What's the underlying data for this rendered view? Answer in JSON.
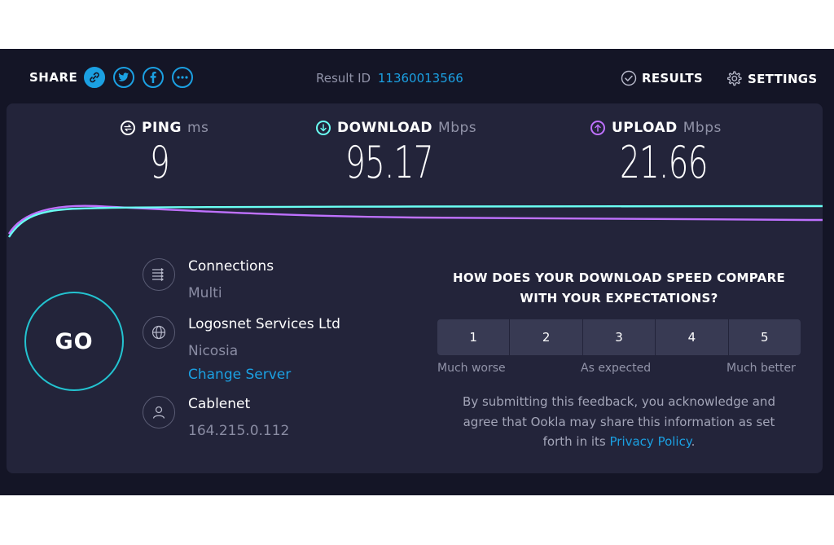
{
  "header": {
    "share_label": "SHARE",
    "share_icons": [
      "link-icon",
      "twitter-icon",
      "facebook-icon",
      "more-icon"
    ],
    "result_label": "Result ID",
    "result_id": "11360013566",
    "results_label": "RESULTS",
    "settings_label": "SETTINGS"
  },
  "metrics": {
    "ping": {
      "label": "PING",
      "unit": "ms",
      "value": "9",
      "icon": "ping-icon",
      "color": "#ffffff"
    },
    "download": {
      "label": "DOWNLOAD",
      "unit": "Mbps",
      "value": "95.17",
      "icon": "download-arrow-icon",
      "color": "#6afff3"
    },
    "upload": {
      "label": "UPLOAD",
      "unit": "Mbps",
      "value": "21.66",
      "icon": "upload-arrow-icon",
      "color": "#bf71ff"
    }
  },
  "go_label": "GO",
  "connection": {
    "connections_title": "Connections",
    "connections_value": "Multi",
    "server_name": "Logosnet Services Ltd",
    "server_location": "Nicosia",
    "change_server": "Change Server",
    "isp_name": "Cablenet",
    "ip_address": "164.215.0.112"
  },
  "survey": {
    "question_line1": "HOW DOES YOUR DOWNLOAD SPEED COMPARE",
    "question_line2": "WITH YOUR EXPECTATIONS?",
    "options": [
      "1",
      "2",
      "3",
      "4",
      "5"
    ],
    "label_low": "Much worse",
    "label_mid": "As expected",
    "label_high": "Much better",
    "disclaimer_line1": "By submitting this feedback, you acknowledge and",
    "disclaimer_line2": "agree that Ookla may share this information as set",
    "disclaimer_prefix": "forth in its",
    "privacy_link": "Privacy Policy",
    "disclaimer_suffix": "."
  },
  "colors": {
    "background": "#141526",
    "panel": "#23243a",
    "accent_blue": "#1ba0e2",
    "download_line": "#6afff3",
    "upload_line": "#bf71ff",
    "go_ring": "#24c3d0"
  }
}
